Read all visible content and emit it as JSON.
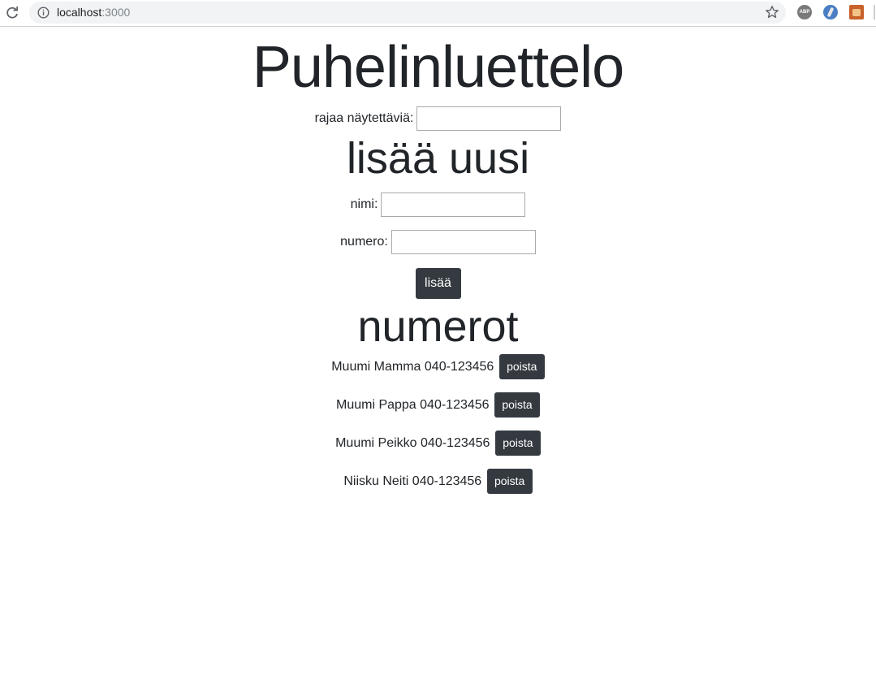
{
  "browser": {
    "url_host": "localhost",
    "url_port": ":3000",
    "extensions": {
      "abp_label": "ABP"
    }
  },
  "page": {
    "title": "Puhelinluettelo",
    "filter": {
      "label": "rajaa näytettäviä:",
      "value": ""
    },
    "add_section": {
      "title": "lisää uusi",
      "name_label": "nimi:",
      "name_value": "",
      "number_label": "numero:",
      "number_value": "",
      "submit_label": "lisää"
    },
    "numbers_section": {
      "title": "numerot",
      "entries": [
        {
          "text": "Muumi Mamma 040-123456",
          "delete_label": "poista"
        },
        {
          "text": "Muumi Pappa 040-123456",
          "delete_label": "poista"
        },
        {
          "text": "Muumi Peikko 040-123456",
          "delete_label": "poista"
        },
        {
          "text": "Niisku Neiti 040-123456",
          "delete_label": "poista"
        }
      ]
    }
  },
  "colors": {
    "button_bg": "#343a40",
    "button_text": "#ffffff",
    "text": "#212529"
  }
}
